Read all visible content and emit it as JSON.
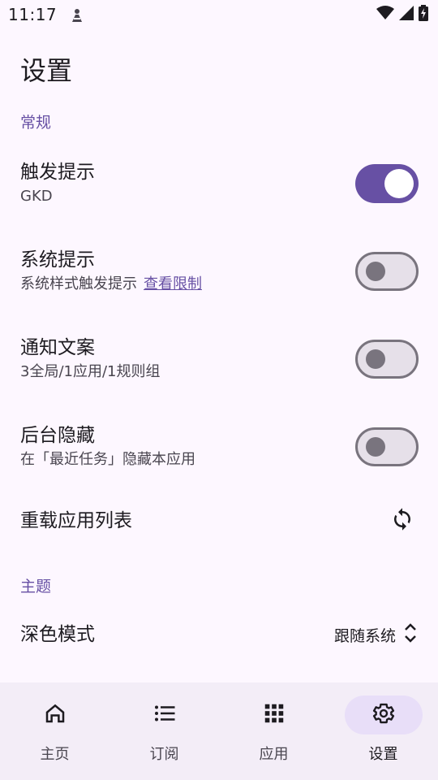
{
  "status_bar": {
    "time": "11:17"
  },
  "page": {
    "title": "设置"
  },
  "sections": {
    "general": {
      "header": "常规",
      "trigger_tip": {
        "title": "触发提示",
        "subtitle": "GKD",
        "enabled": true
      },
      "system_tip": {
        "title": "系统提示",
        "subtitle": "系统样式触发提示",
        "link": "查看限制",
        "enabled": false
      },
      "notify_text": {
        "title": "通知文案",
        "subtitle": "3全局/1应用/1规则组",
        "enabled": false
      },
      "hide_background": {
        "title": "后台隐藏",
        "subtitle": "在「最近任务」隐藏本应用",
        "enabled": false
      },
      "reload_apps": {
        "title": "重载应用列表"
      }
    },
    "theme": {
      "header": "主题",
      "dark_mode": {
        "title": "深色模式",
        "value": "跟随系统"
      }
    }
  },
  "bottom_nav": {
    "items": [
      {
        "label": "主页",
        "icon": "home-icon"
      },
      {
        "label": "订阅",
        "icon": "list-icon"
      },
      {
        "label": "应用",
        "icon": "apps-grid-icon"
      },
      {
        "label": "设置",
        "icon": "gear-icon"
      }
    ],
    "active_index": 3
  },
  "colors": {
    "accent": "#6750a4",
    "background": "#fdf7ff",
    "nav_background": "#f3edf7",
    "active_pill": "#e8def8"
  }
}
